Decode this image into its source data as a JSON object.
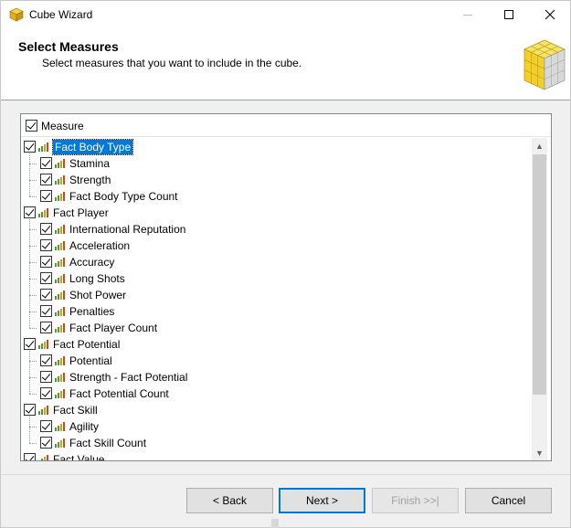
{
  "window": {
    "title": "Cube Wizard"
  },
  "header": {
    "title": "Select Measures",
    "subtitle": "Select measures that you want to include in the cube."
  },
  "tree": {
    "column_header": "Measure",
    "rows": [
      {
        "label": "Fact Body Type",
        "level": 0,
        "checked": true,
        "selected": true
      },
      {
        "label": "Stamina",
        "level": 1,
        "checked": true
      },
      {
        "label": "Strength",
        "level": 1,
        "checked": true
      },
      {
        "label": "Fact Body Type Count",
        "level": 1,
        "checked": true
      },
      {
        "label": "Fact Player",
        "level": 0,
        "checked": true
      },
      {
        "label": "International Reputation",
        "level": 1,
        "checked": true
      },
      {
        "label": "Acceleration",
        "level": 1,
        "checked": true
      },
      {
        "label": "Accuracy",
        "level": 1,
        "checked": true
      },
      {
        "label": "Long Shots",
        "level": 1,
        "checked": true
      },
      {
        "label": "Shot Power",
        "level": 1,
        "checked": true
      },
      {
        "label": "Penalties",
        "level": 1,
        "checked": true
      },
      {
        "label": "Fact Player Count",
        "level": 1,
        "checked": true
      },
      {
        "label": "Fact Potential",
        "level": 0,
        "checked": true
      },
      {
        "label": "Potential",
        "level": 1,
        "checked": true
      },
      {
        "label": "Strength - Fact Potential",
        "level": 1,
        "checked": true
      },
      {
        "label": "Fact Potential Count",
        "level": 1,
        "checked": true
      },
      {
        "label": "Fact Skill",
        "level": 0,
        "checked": true
      },
      {
        "label": "Agility",
        "level": 1,
        "checked": true
      },
      {
        "label": "Fact Skill Count",
        "level": 1,
        "checked": true
      },
      {
        "label": "Fact Value",
        "level": 0,
        "checked": true
      }
    ]
  },
  "buttons": {
    "back": "< Back",
    "next": "Next >",
    "finish": "Finish >>|",
    "cancel": "Cancel"
  },
  "colors": {
    "selection": "#0078d7",
    "accent_border": "#0078d7"
  }
}
